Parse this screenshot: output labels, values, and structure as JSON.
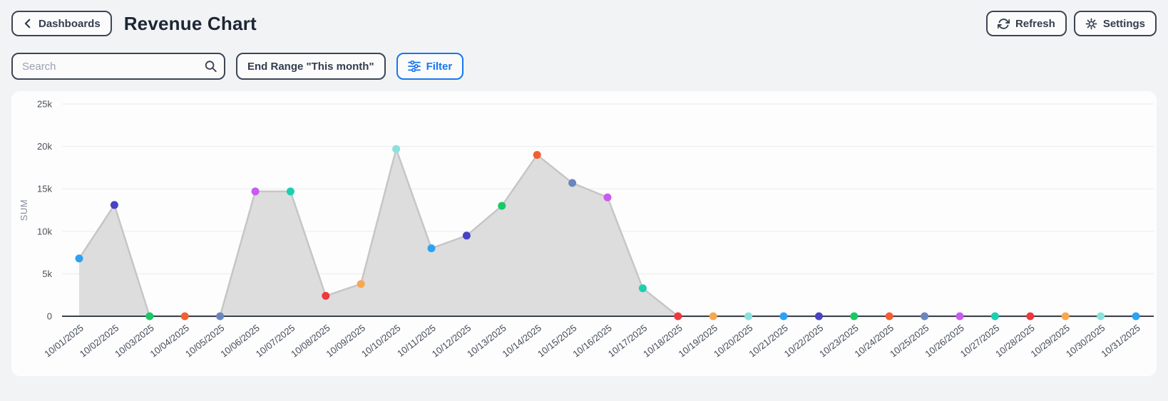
{
  "header": {
    "back_label": "Dashboards",
    "title": "Revenue Chart",
    "refresh_label": "Refresh",
    "settings_label": "Settings"
  },
  "toolbar": {
    "search_placeholder": "Search",
    "end_range_label": "End Range \"This month\"",
    "filter_label": "Filter"
  },
  "colors": {
    "accent_blue": "#1677f2",
    "text_dark": "#333e4e",
    "tick_text": "#4b5158",
    "date_text": "#444b57",
    "ylabel_text": "#8a9099",
    "grid_line": "#ebebeb",
    "axis_line": "#3c414b",
    "area_fill": "#d9d9d9",
    "line": "#c6c6c6",
    "card_bg": "#fdfdfe",
    "page_bg": "#f2f3f5"
  },
  "chart_data": {
    "type": "area",
    "title": "Revenue Chart",
    "xlabel": "",
    "ylabel": "SUM",
    "ylim": [
      0,
      25000
    ],
    "yticks": [
      "0",
      "5k",
      "10k",
      "15k",
      "20k",
      "25k"
    ],
    "grid": true,
    "legend": false,
    "x": [
      "10/01/2025",
      "10/02/2025",
      "10/03/2025",
      "10/04/2025",
      "10/05/2025",
      "10/06/2025",
      "10/07/2025",
      "10/08/2025",
      "10/09/2025",
      "10/10/2025",
      "10/11/2025",
      "10/12/2025",
      "10/13/2025",
      "10/14/2025",
      "10/15/2025",
      "10/16/2025",
      "10/17/2025",
      "10/18/2025",
      "10/19/2025",
      "10/20/2025",
      "10/21/2025",
      "10/22/2025",
      "10/23/2025",
      "10/24/2025",
      "10/25/2025",
      "10/26/2025",
      "10/27/2025",
      "10/28/2025",
      "10/29/2025",
      "10/30/2025",
      "10/31/2025"
    ],
    "values": [
      6800,
      13100,
      0,
      0,
      0,
      14700,
      14700,
      2400,
      3800,
      19700,
      8000,
      9500,
      13000,
      19000,
      15700,
      14000,
      3300,
      0,
      0,
      0,
      0,
      0,
      0,
      0,
      0,
      0,
      0,
      0,
      0,
      0,
      0
    ],
    "palette": [
      "#2CA2F4",
      "#4843C2",
      "#1BC866",
      "#F25F31",
      "#6B86BE",
      "#C95BF0",
      "#1CCFB0",
      "#EE393E",
      "#F8A751",
      "#8BE1DE"
    ]
  }
}
